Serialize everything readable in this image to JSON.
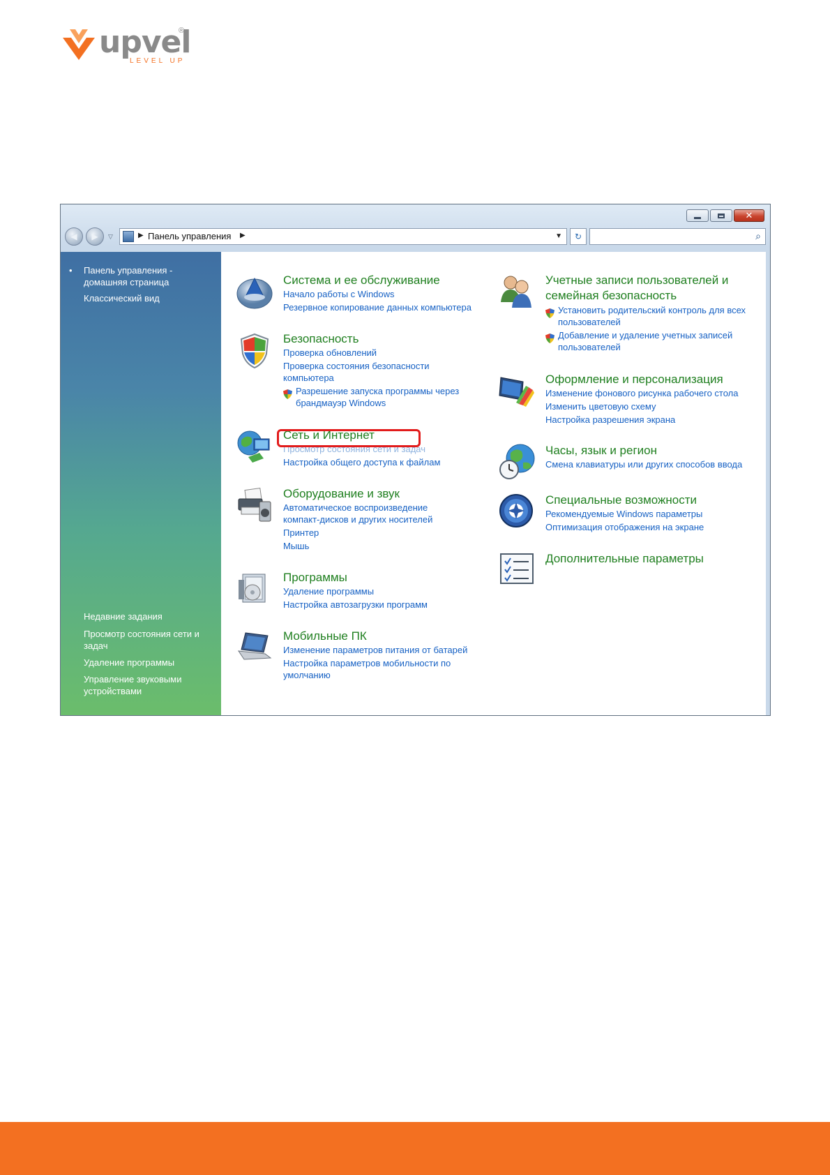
{
  "logo": {
    "word": "upvel",
    "tagline": "LEVEL UP",
    "registered": "®"
  },
  "window": {
    "controls": {
      "minimize": "minimize-icon",
      "maximize": "maximize-icon",
      "close": "✕"
    },
    "address": {
      "path": "Панель управления"
    },
    "search": {
      "placeholder": ""
    }
  },
  "sidebar": {
    "home": "Панель управления - домашняя страница",
    "classic": "Классический вид",
    "recent_title": "Недавние задания",
    "recent": [
      "Просмотр состояния сети и задач",
      "Удаление программы",
      "Управление звуковыми устройствами"
    ]
  },
  "categories": {
    "system": {
      "title": "Система и ее обслуживание",
      "links": [
        "Начало работы с Windows",
        "Резервное копирование данных компьютера"
      ]
    },
    "security": {
      "title": "Безопасность",
      "links": [
        "Проверка обновлений",
        "Проверка состояния безопасности компьютера"
      ],
      "shield_link": "Разрешение запуска программы через брандмауэр Windows"
    },
    "network": {
      "title": "Сеть и Интернет",
      "links": [
        "Просмотр состояния сети и задач",
        "Настройка общего доступа к файлам"
      ]
    },
    "hardware": {
      "title": "Оборудование и звук",
      "links": [
        "Автоматическое воспроизведение компакт-дисков и других носителей",
        "Принтер",
        "Мышь"
      ]
    },
    "programs": {
      "title": "Программы",
      "links": [
        "Удаление программы",
        "Настройка автозагрузки программ"
      ]
    },
    "mobile": {
      "title": "Мобильные ПК",
      "links": [
        "Изменение параметров питания от батарей",
        "Настройка параметров мобильности по умолчанию"
      ]
    },
    "users": {
      "title": "Учетные записи пользователей и семейная безопасность",
      "shield_links": [
        "Установить родительский контроль для всех пользователей",
        "Добавление и удаление учетных записей пользователей"
      ]
    },
    "appearance": {
      "title": "Оформление и персонализация",
      "links": [
        "Изменение фонового рисунка рабочего стола",
        "Изменить цветовую схему",
        "Настройка разрешения экрана"
      ]
    },
    "clock": {
      "title": "Часы, язык и регион",
      "links": [
        "Смена клавиатуры или других способов ввода"
      ]
    },
    "access": {
      "title": "Специальные возможности",
      "links": [
        "Рекомендуемые Windows параметры",
        "Оптимизация отображения на экране"
      ]
    },
    "extra": {
      "title": "Дополнительные параметры"
    }
  },
  "colors": {
    "brand_orange": "#f37021",
    "category_title": "#1f7f1f",
    "link_blue": "#1661c4",
    "highlight_red": "#e21b1b"
  }
}
